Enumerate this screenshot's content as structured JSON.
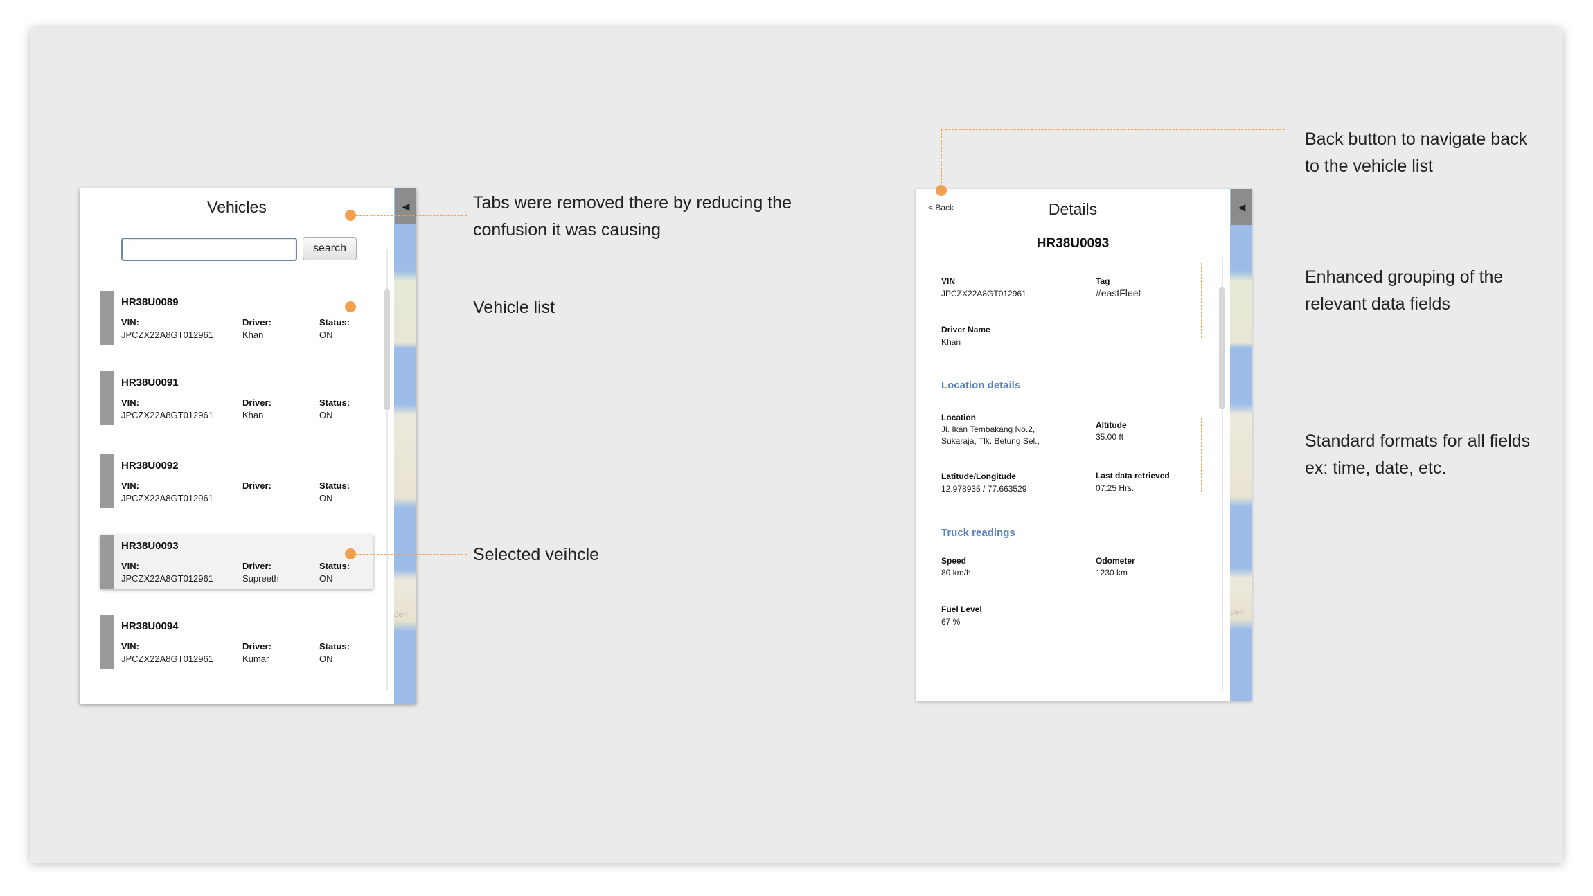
{
  "vehicles_panel": {
    "title": "Vehicles",
    "search_value": "",
    "search_button": "search",
    "collapse_glyph": "◀",
    "map_label": "den",
    "items": [
      {
        "id": "HR38U0089",
        "vin_label": "VIN:",
        "vin": "JPCZX22A8GT012961",
        "driver_label": "Driver:",
        "driver": "Khan",
        "status_label": "Status:",
        "status": "ON",
        "selected": false
      },
      {
        "id": "HR38U0091",
        "vin_label": "VIN:",
        "vin": "JPCZX22A8GT012961",
        "driver_label": "Driver:",
        "driver": "Khan",
        "status_label": "Status:",
        "status": "ON",
        "selected": false
      },
      {
        "id": "HR38U0092",
        "vin_label": "VIN:",
        "vin": "JPCZX22A8GT012961",
        "driver_label": "Driver:",
        "driver": "- - -",
        "status_label": "Status:",
        "status": "ON",
        "selected": false
      },
      {
        "id": "HR38U0093",
        "vin_label": "VIN:",
        "vin": "JPCZX22A8GT012961",
        "driver_label": "Driver:",
        "driver": "Supreeth",
        "status_label": "Status:",
        "status": "ON",
        "selected": true
      },
      {
        "id": "HR38U0094",
        "vin_label": "VIN:",
        "vin": "JPCZX22A8GT012961",
        "driver_label": "Driver:",
        "driver": "Kumar",
        "status_label": "Status:",
        "status": "ON",
        "selected": false
      }
    ]
  },
  "details_panel": {
    "back_label": "< Back",
    "title": "Details",
    "vehicle_id": "HR38U0093",
    "collapse_glyph": "◀",
    "map_label": "den",
    "vin_label": "VIN",
    "vin": "JPCZX22A8GT012961",
    "tag_label": "Tag",
    "tag": "#eastFleet",
    "driver_name_label": "Driver Name",
    "driver_name": "Khan",
    "location_section": "Location details",
    "location_label": "Location",
    "location_line1": "Jl. Ikan Tembakang No.2,",
    "location_line2": "Sukaraja, Tlk.  Betung Sel.,",
    "altitude_label": "Altitude",
    "altitude": "35.00 ft",
    "latlong_label": "Latitude/Longitude",
    "latlong": "12.978935 / 77.663529",
    "last_data_label": "Last data retrieved",
    "last_data": "07:25 Hrs.",
    "truck_section": "Truck readings",
    "speed_label": "Speed",
    "speed": "80 km/h",
    "odometer_label": "Odometer",
    "odometer": "1230 km",
    "fuel_label": "Fuel Level",
    "fuel": "67 %"
  },
  "annotations": {
    "tabs_removed": "Tabs were removed there by reducing the\nconfusion it was causing",
    "vehicle_list": "Vehicle list",
    "selected_vehicle": "Selected veihcle",
    "back_button": "Back button to navigate back\nto the vehicle list",
    "grouping": "Enhanced grouping of the\nrelevant data fields",
    "formats": "Standard formats for all fields\nex: time, date, etc."
  },
  "colors": {
    "annotation_accent": "#f0a04e",
    "section_heading": "#5b83c0",
    "map_water": "#9dbde8"
  }
}
